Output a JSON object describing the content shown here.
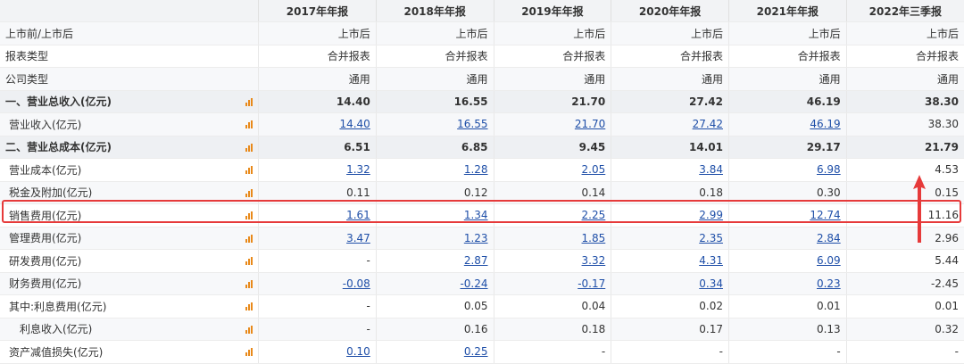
{
  "header": {
    "years": [
      "2017年年报",
      "2018年年报",
      "2019年年报",
      "2020年年报",
      "2021年年报",
      "2022年三季报"
    ]
  },
  "rows": [
    {
      "label": "上市前/上市后",
      "values": [
        "上市后",
        "上市后",
        "上市后",
        "上市后",
        "上市后",
        "上市后"
      ]
    },
    {
      "label": "报表类型",
      "values": [
        "合并报表",
        "合并报表",
        "合并报表",
        "合并报表",
        "合并报表",
        "合并报表"
      ]
    },
    {
      "label": "公司类型",
      "values": [
        "通用",
        "通用",
        "通用",
        "通用",
        "通用",
        "通用"
      ]
    },
    {
      "label": "一、营业总收入(亿元)",
      "values": [
        "14.40",
        "16.55",
        "21.70",
        "27.42",
        "46.19",
        "38.30"
      ]
    },
    {
      "label": "营业收入(亿元)",
      "values": [
        "14.40",
        "16.55",
        "21.70",
        "27.42",
        "46.19",
        "38.30"
      ]
    },
    {
      "label": "二、营业总成本(亿元)",
      "values": [
        "6.51",
        "6.85",
        "9.45",
        "14.01",
        "29.17",
        "21.79"
      ]
    },
    {
      "label": "营业成本(亿元)",
      "values": [
        "1.32",
        "1.28",
        "2.05",
        "3.84",
        "6.98",
        "4.53"
      ]
    },
    {
      "label": "税金及附加(亿元)",
      "values": [
        "0.11",
        "0.12",
        "0.14",
        "0.18",
        "0.30",
        "0.15"
      ]
    },
    {
      "label": "销售费用(亿元)",
      "values": [
        "1.61",
        "1.34",
        "2.25",
        "2.99",
        "12.74",
        "11.16"
      ]
    },
    {
      "label": "管理费用(亿元)",
      "values": [
        "3.47",
        "1.23",
        "1.85",
        "2.35",
        "2.84",
        "2.96"
      ]
    },
    {
      "label": "研发费用(亿元)",
      "values": [
        "-",
        "2.87",
        "3.32",
        "4.31",
        "6.09",
        "5.44"
      ]
    },
    {
      "label": "财务费用(亿元)",
      "values": [
        "-0.08",
        "-0.24",
        "-0.17",
        "0.34",
        "0.23",
        "-2.45"
      ]
    },
    {
      "label": "其中:利息费用(亿元)",
      "values": [
        "-",
        "0.05",
        "0.04",
        "0.02",
        "0.01",
        "0.01"
      ]
    },
    {
      "label": "利息收入(亿元)",
      "values": [
        "-",
        "0.16",
        "0.18",
        "0.17",
        "0.13",
        "0.32"
      ]
    },
    {
      "label": "资产减值损失(亿元)",
      "values": [
        "0.10",
        "0.25",
        "-",
        "-",
        "-",
        "-"
      ]
    }
  ],
  "icon": "bar-chart-icon",
  "colors": {
    "highlight": "#e63a3a",
    "link": "#1f4fa8",
    "icon": "#e8891a",
    "header_bg": "#f2f3f5"
  }
}
